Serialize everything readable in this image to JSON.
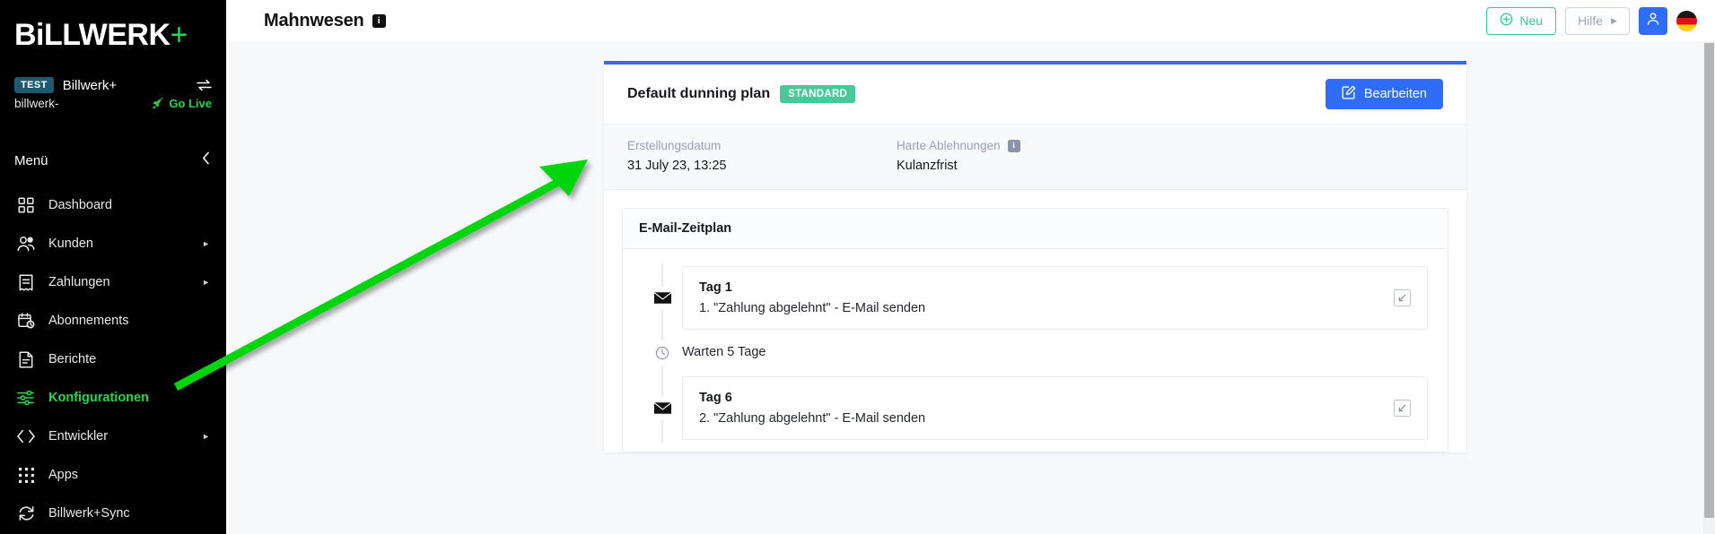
{
  "brand": {
    "logo_text": "BiLLWERK",
    "logo_plus": "+"
  },
  "tenant": {
    "badge": "TEST",
    "name": "Billwerk+",
    "subdomain": "billwerk-",
    "go_live": "Go Live",
    "swap_icon": "swap-arrows-icon"
  },
  "sidebar": {
    "menu_label": "Menü",
    "collapse_icon": "chevron-left-icon",
    "items": [
      {
        "label": "Dashboard",
        "icon": "grid-icon",
        "has_caret": false,
        "active": false
      },
      {
        "label": "Kunden",
        "icon": "users-icon",
        "has_caret": true,
        "active": false
      },
      {
        "label": "Zahlungen",
        "icon": "receipt-icon",
        "has_caret": true,
        "active": false
      },
      {
        "label": "Abonnements",
        "icon": "calendar-clock-icon",
        "has_caret": false,
        "active": false
      },
      {
        "label": "Berichte",
        "icon": "document-icon",
        "has_caret": false,
        "active": false
      },
      {
        "label": "Konfigurationen",
        "icon": "sliders-icon",
        "has_caret": false,
        "active": true
      },
      {
        "label": "Entwickler",
        "icon": "code-icon",
        "has_caret": true,
        "active": false
      },
      {
        "label": "Apps",
        "icon": "apps-grid-icon",
        "has_caret": false,
        "active": false
      },
      {
        "label": "Billwerk+Sync",
        "icon": "sync-icon",
        "has_caret": false,
        "active": false
      }
    ]
  },
  "header": {
    "title": "Mahnwesen",
    "title_info_icon": "info-icon",
    "info_glyph": "i",
    "new_button": "Neu",
    "new_icon": "plus-circle-icon",
    "help_button": "Hilfe",
    "help_caret": "▶",
    "user_icon": "user-avatar-icon",
    "flag_icon": "german-flag-icon"
  },
  "plan": {
    "title": "Default dunning plan",
    "badge": "STANDARD",
    "edit_button": "Bearbeiten",
    "edit_icon": "pencil-square-icon",
    "meta": [
      {
        "label": "Erstellungsdatum",
        "value": "31 July 23, 13:25",
        "info": false
      },
      {
        "label": "Harte Ablehnungen",
        "value": "Kulanzfrist",
        "info": true,
        "info_glyph": "i"
      }
    ]
  },
  "schedule": {
    "heading": "E-Mail-Zeitplan",
    "steps": [
      {
        "kind": "email",
        "icon": "envelope-icon",
        "day": "Tag 1",
        "description": "1. \"Zahlung abgelehnt\" - E-Mail senden",
        "expand_icon": "expand-arrow-icon"
      },
      {
        "kind": "wait",
        "icon": "clock-icon",
        "text": "Warten 5 Tage"
      },
      {
        "kind": "email",
        "icon": "envelope-icon",
        "day": "Tag 6",
        "description": "2. \"Zahlung abgelehnt\" - E-Mail senden",
        "expand_icon": "expand-arrow-icon"
      }
    ]
  },
  "colors": {
    "brand_green": "#1ed94b",
    "accent_blue": "#2f6df6",
    "badge_green": "#47c99a",
    "sidebar_bg": "#000000",
    "annotation_green": "#00d50f"
  },
  "annotation": {
    "type": "arrow",
    "from": "Konfigurationen menu item",
    "to": "dunning plan card area"
  }
}
